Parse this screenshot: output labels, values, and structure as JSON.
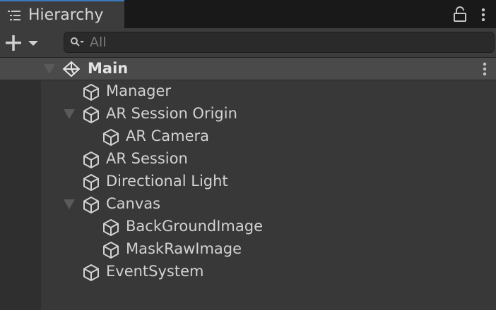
{
  "tab": {
    "title": "Hierarchy",
    "tab_icon": "hierarchy-list-icon",
    "lock_icon": "lock-icon",
    "menu_icon": "kebab-menu-icon"
  },
  "toolbar": {
    "create_icon": "plus-icon",
    "dropdown_icon": "caret-down-icon",
    "search": {
      "placeholder": "All",
      "value": "",
      "icon": "search-icon"
    }
  },
  "scene": {
    "label": "Main",
    "expanded": true,
    "icon": "unity-logo-icon",
    "menu_icon": "kebab-menu-icon"
  },
  "objects": [
    {
      "label": "Manager",
      "depth": 1,
      "expandable": false,
      "expanded": false
    },
    {
      "label": "AR Session Origin",
      "depth": 1,
      "expandable": true,
      "expanded": true
    },
    {
      "label": "AR Camera",
      "depth": 2,
      "expandable": false,
      "expanded": false
    },
    {
      "label": "AR Session",
      "depth": 1,
      "expandable": false,
      "expanded": false
    },
    {
      "label": "Directional Light",
      "depth": 1,
      "expandable": false,
      "expanded": false
    },
    {
      "label": "Canvas",
      "depth": 1,
      "expandable": true,
      "expanded": true
    },
    {
      "label": "BackGroundImage",
      "depth": 2,
      "expandable": false,
      "expanded": false
    },
    {
      "label": "MaskRawImage",
      "depth": 2,
      "expandable": false,
      "expanded": false
    },
    {
      "label": "EventSystem",
      "depth": 1,
      "expandable": false,
      "expanded": false
    }
  ],
  "colors": {
    "background": "#383838",
    "tab_bar": "#191919",
    "tab_active": "#3c3c3c",
    "tab_accent": "#3a79bb",
    "scene_row": "#4a4a4a",
    "text": "#d2d2d2"
  }
}
